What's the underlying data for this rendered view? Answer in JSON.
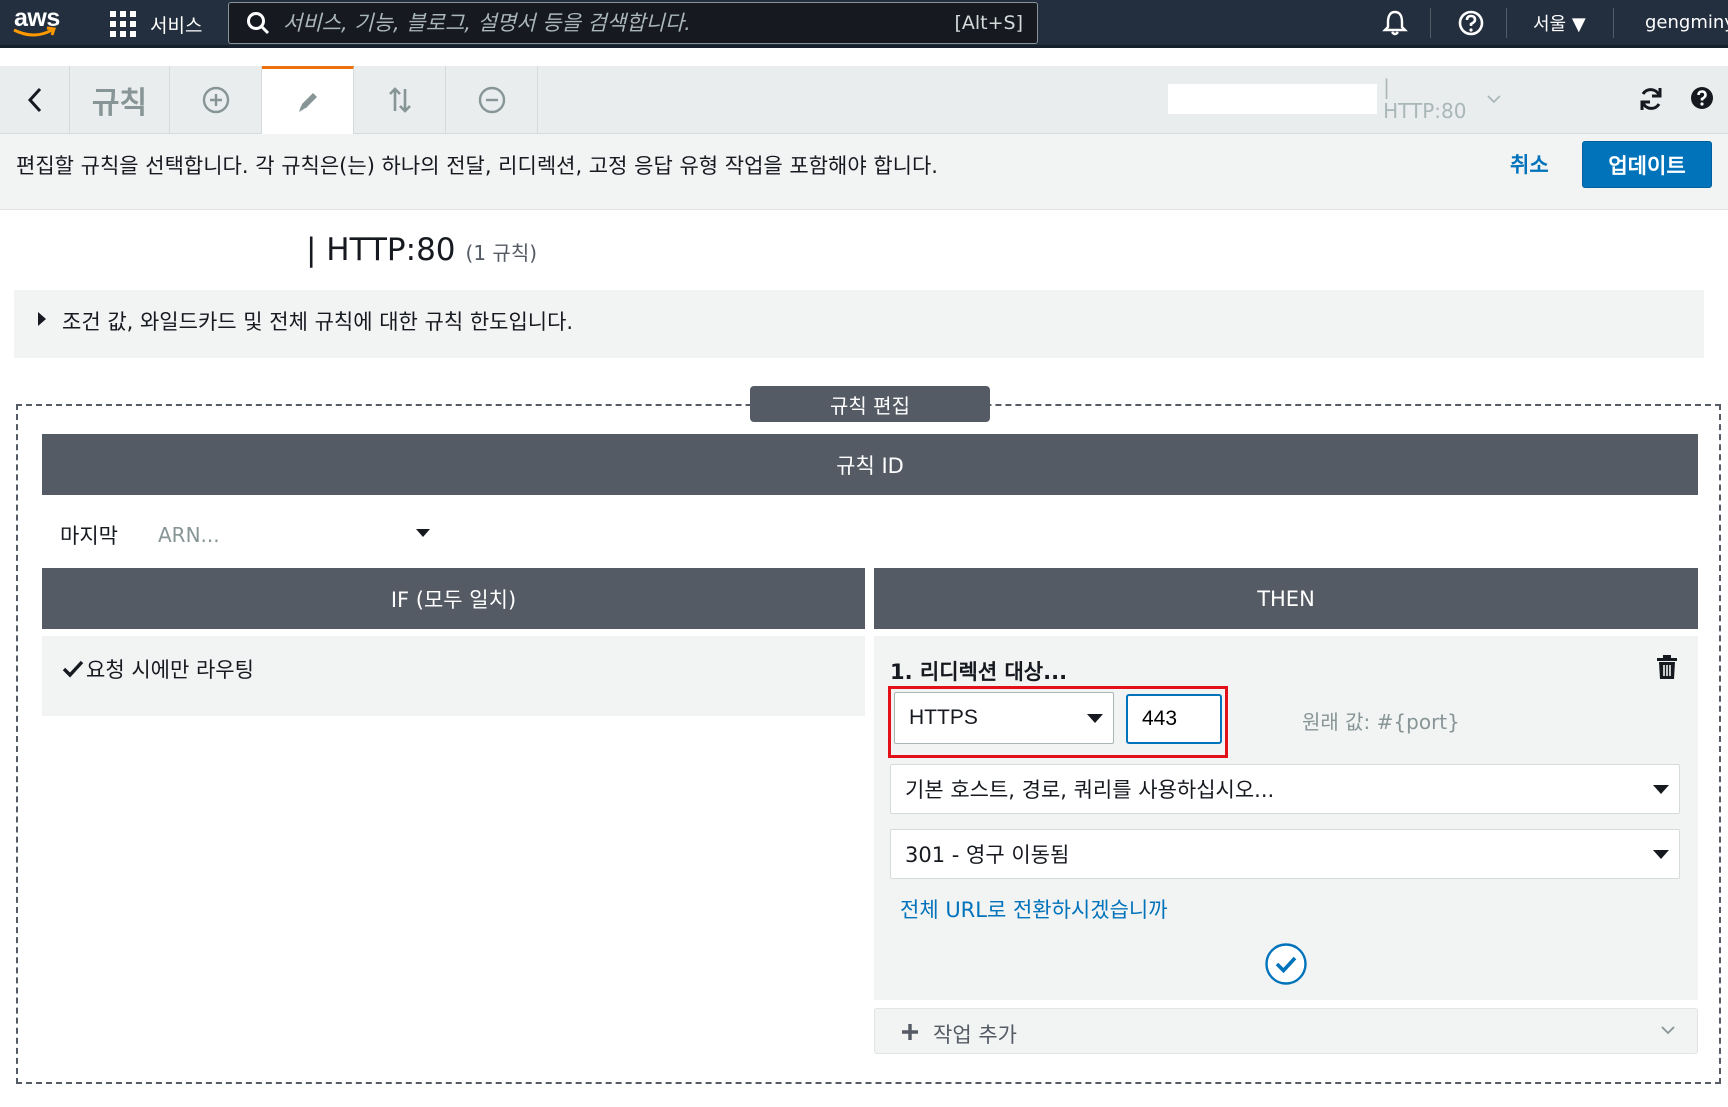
{
  "nav": {
    "logo": "aws",
    "services_label": "서비스",
    "search_placeholder": "서비스, 기능, 블로그, 설명서 등을 검색합니다.",
    "search_shortcut": "[Alt+S]",
    "region": "서울 ▼",
    "user": "gengminy"
  },
  "toolbar": {
    "rules_label": "규칙",
    "listener": "| HTTP:80"
  },
  "instruction": {
    "text": "편집할 규칙을 선택합니다. 각 규칙은(는) 하나의 전달, 리디렉션, 고정 응답 유형 작업을 포함해야 합니다.",
    "cancel": "취소",
    "update": "업데이트"
  },
  "listener_header": {
    "title": "| HTTP:80",
    "count": "(1 규칙)"
  },
  "limits_text": "조건 값, 와일드카드 및 전체 규칙에 대한 규칙 한도입니다.",
  "editor": {
    "frame_label": "규칙 편집",
    "rule_id_header": "규칙 ID",
    "priority_label": "마지막",
    "arn_placeholder": "ARN...",
    "if_header": "IF (모두 일치)",
    "then_header": "THEN",
    "if_condition": "요청 시에만 라우팅",
    "action_title": "1. 리디렉션 대상...",
    "protocol": "HTTPS",
    "port": "443",
    "original_value": "원래 값: #{port}",
    "host_option": "기본 호스트, 경로, 쿼리를 사용하십시오...",
    "status_code": "301 - 영구 이동됨",
    "full_url_link": "전체 URL로 전환하시겠습니까",
    "add_action": "작업 추가"
  },
  "colors": {
    "nav_bg": "#232f3e",
    "accent_orange": "#ec7211",
    "link_blue": "#0073bb",
    "header_gray": "#545b64",
    "highlight_red": "#e3101a"
  }
}
